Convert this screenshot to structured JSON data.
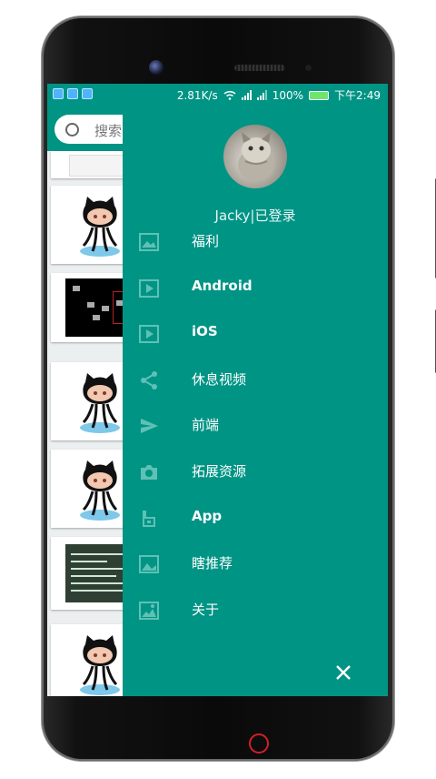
{
  "status_bar": {
    "speed": "2.81K/s",
    "battery": "100%",
    "time": "下午2:49"
  },
  "search": {
    "placeholder": "搜索..."
  },
  "drawer": {
    "user_label": "Jacky|已登录",
    "menu": [
      {
        "label": "福利",
        "icon": "image-icon"
      },
      {
        "label": "Android",
        "icon": "play-video-icon"
      },
      {
        "label": "iOS",
        "icon": "play-video-icon"
      },
      {
        "label": "休息视频",
        "icon": "share-icon"
      },
      {
        "label": "前端",
        "icon": "send-icon"
      },
      {
        "label": "拓展资源",
        "icon": "camera-icon"
      },
      {
        "label": "App",
        "icon": "plug-icon"
      },
      {
        "label": "瞎推荐",
        "icon": "photo-icon"
      },
      {
        "label": "关于",
        "icon": "landscape-icon"
      }
    ]
  },
  "colors": {
    "primary": "#009485",
    "background": "#eceff0"
  }
}
